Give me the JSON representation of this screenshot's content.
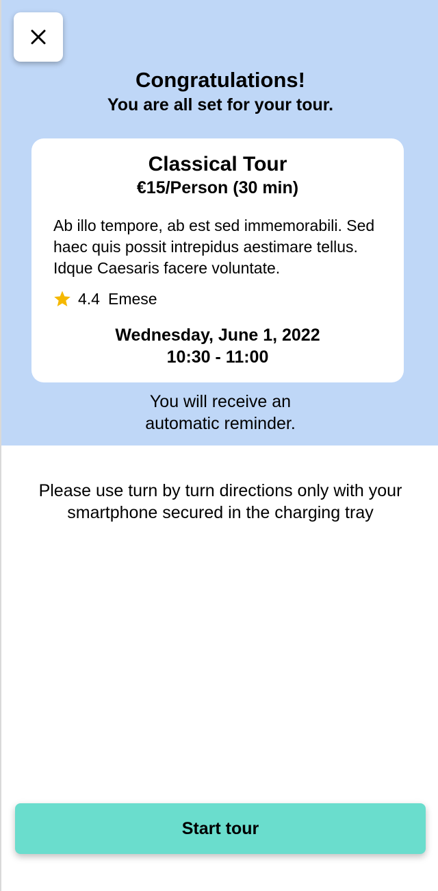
{
  "header": {
    "close_icon": "close-icon",
    "title": "Congratulations!",
    "subtitle": "You are all set for your tour."
  },
  "tour": {
    "name": "Classical Tour",
    "price": "€15/Person (30 min)",
    "description": "Ab illo tempore, ab est sed immemorabili. Sed haec quis possit intrepidus aestimare tellus. Idque Caesaris facere voluntate.",
    "rating": "4.4",
    "rating_icon": "star-icon",
    "guide": "Emese",
    "date": "Wednesday, June 1, 2022",
    "time": "10:30 - 11:00"
  },
  "reminder": "You will receive an automatic reminder.",
  "directions": "Please use turn by turn directions only with your smartphone secured in the charging tray",
  "actions": {
    "start_label": "Start tour"
  },
  "colors": {
    "top_background": "#bfd7f7",
    "card_background": "#ffffff",
    "star": "#f5b800",
    "start_button": "#6addcd"
  }
}
